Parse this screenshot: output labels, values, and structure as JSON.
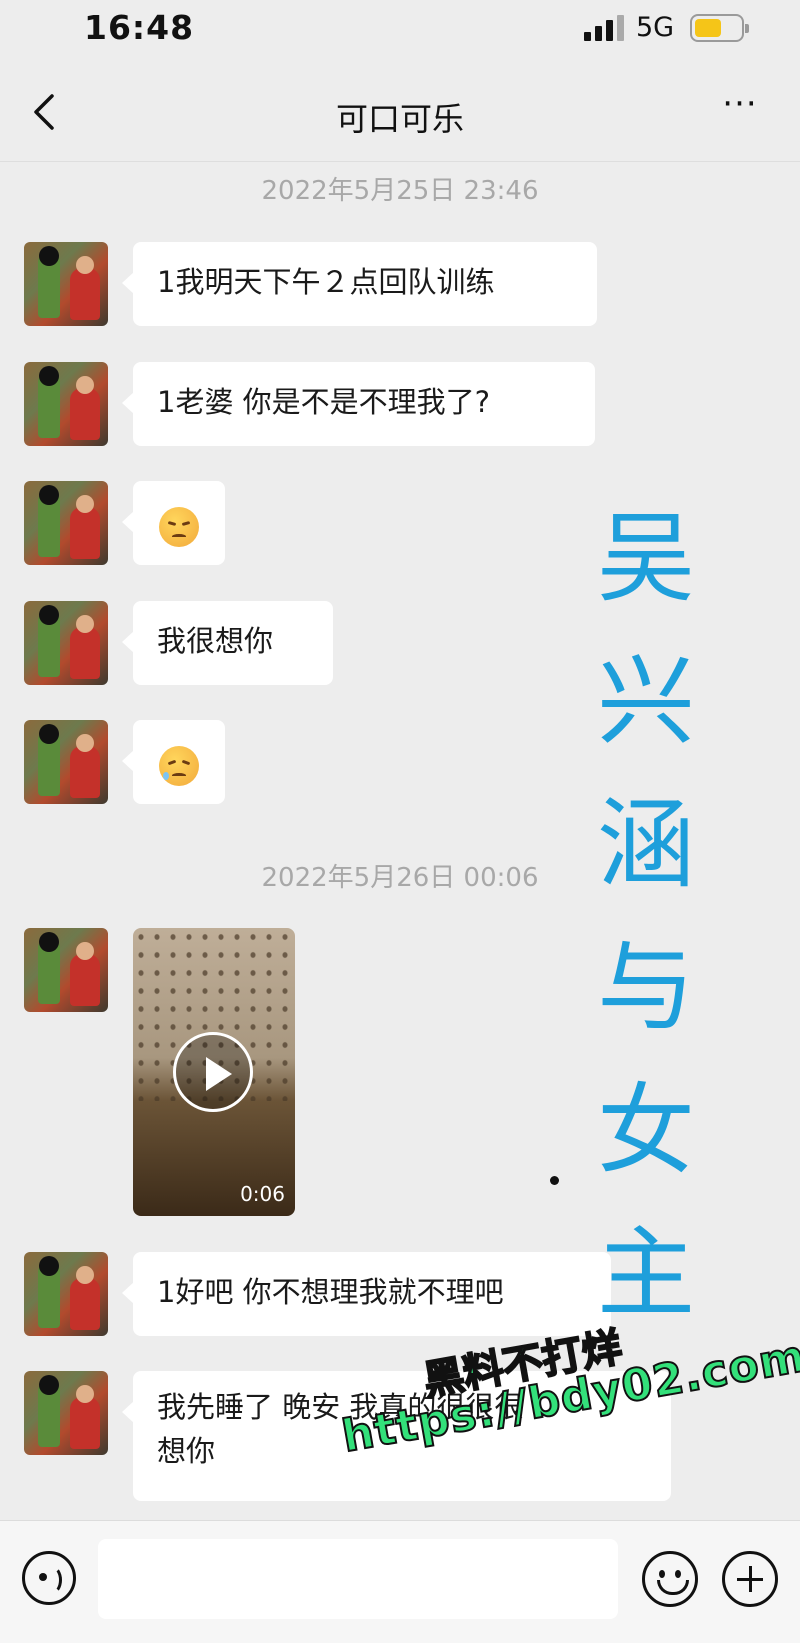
{
  "status_bar": {
    "time": "16:48",
    "network": "5G",
    "battery_level": 0.6
  },
  "nav": {
    "title": "可口可乐",
    "back_icon": "chevron-left-icon",
    "more_label": "···"
  },
  "timestamps": [
    "2022年5月25日 23:46",
    "2022年5月26日 00:06"
  ],
  "messages": [
    {
      "type": "text",
      "text": "1我明天下午２点回队训练"
    },
    {
      "type": "text",
      "text": "1老婆 你是不是不理我了?"
    },
    {
      "type": "emoji",
      "icon": "sad-face-emoji"
    },
    {
      "type": "text",
      "text": "我很想你"
    },
    {
      "type": "emoji",
      "icon": "crying-face-emoji"
    },
    {
      "type": "video",
      "duration": "0:06"
    },
    {
      "type": "text",
      "text": "1好吧 你不想理我就不理吧"
    },
    {
      "type": "text",
      "line1": "我先睡了 晚安 我真的很很很",
      "line2": "想你"
    }
  ],
  "overlay": {
    "chars": [
      "吴",
      "兴",
      "涵",
      "与",
      "女",
      "主"
    ],
    "color": "#1e9fdb"
  },
  "watermark": {
    "line1": "黑料不打烊",
    "line2": "https://bdy02.com",
    "color": "#33e07a"
  },
  "input_bar": {
    "placeholder": ""
  },
  "colors": {
    "background": "#ededed",
    "bubble": "#ffffff",
    "timestamp": "#a8a8a8"
  }
}
